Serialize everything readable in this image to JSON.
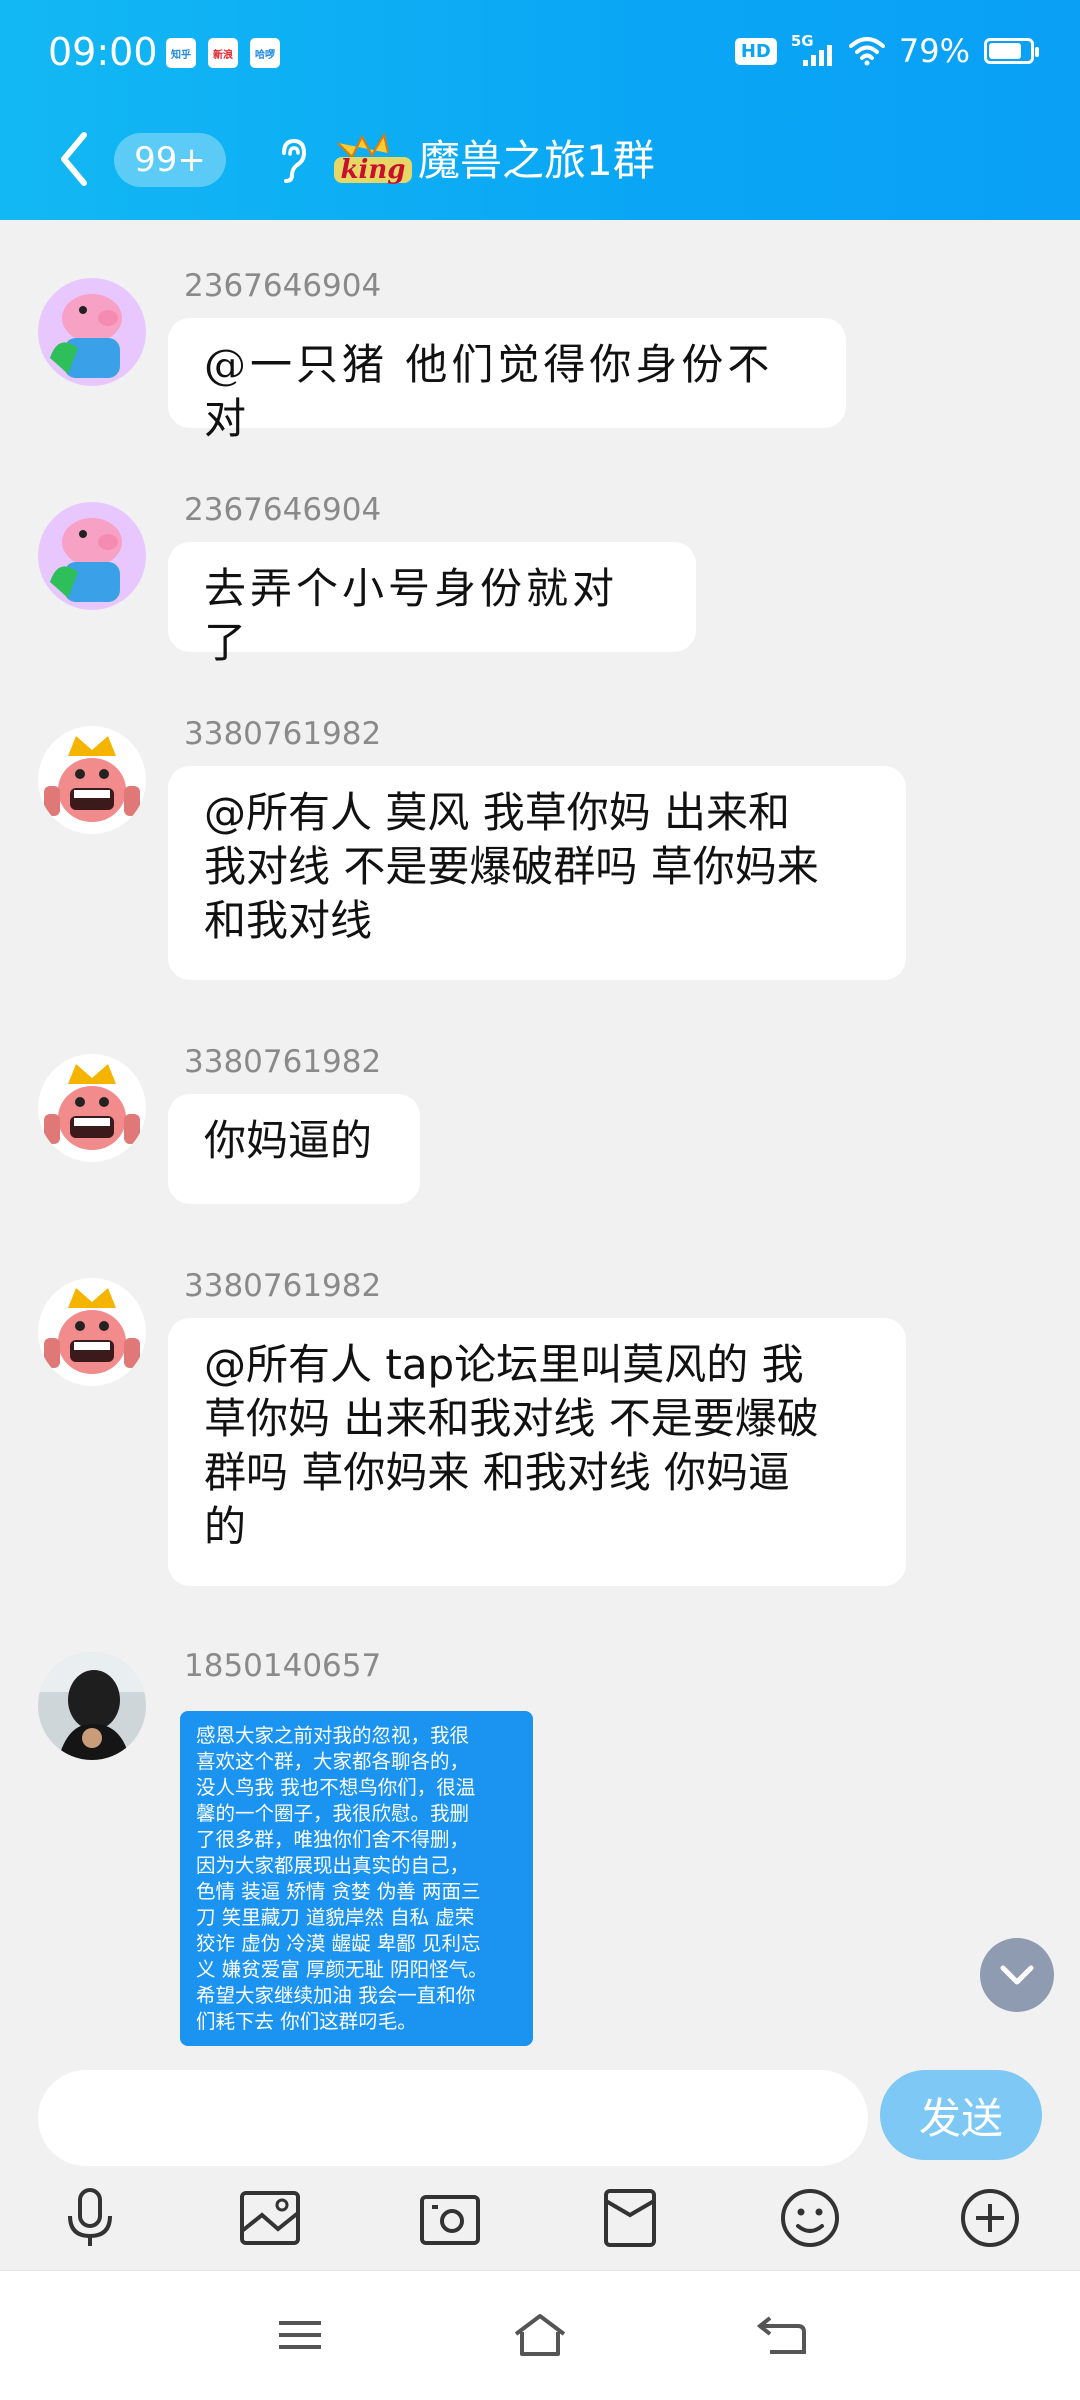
{
  "status_bar": {
    "time": "09:00",
    "apps": [
      "知乎",
      "新浪",
      "哈啰"
    ],
    "hd": "HD",
    "network": "5G",
    "battery": "79%",
    "battery_level": 0.79
  },
  "titlebar": {
    "unread_badge": "99+",
    "king_label": "king",
    "group_name": "魔兽之旅1群"
  },
  "messages": [
    {
      "sender": "2367646904",
      "text": "@一只猪 他们觉得你身份不对"
    },
    {
      "sender": "2367646904",
      "text": "去弄个小号身份就对了"
    },
    {
      "sender": "3380761982",
      "lines": [
        "@所有人  莫风 我草你妈 出来和",
        "我对线 不是要爆破群吗 草你妈来",
        "和我对线"
      ]
    },
    {
      "sender": "3380761982",
      "text": "你妈逼的"
    },
    {
      "sender": "3380761982",
      "lines": [
        "@所有人  tap论坛里叫莫风的 我",
        "草你妈 出来和我对线 不是要爆破",
        "群吗 草你妈来 和我对线 你妈逼",
        "的"
      ]
    },
    {
      "sender": "1850140657",
      "image_lines": [
        "感恩大家之前对我的忽视，我很",
        "喜欢这个群，大家都各聊各的，",
        "没人鸟我 我也不想鸟你们，很温",
        "馨的一个圈子，我很欣慰。我删",
        "了很多群，唯独你们舍不得删，",
        "因为大家都展现出真实的自己，",
        "色情 装逼 矫情 贪婪 伪善 两面三",
        "刀 笑里藏刀 道貌岸然 自私 虚荣",
        "狡诈 虚伪 冷漠 龌龊 卑鄙 见利忘",
        "义 嫌贫爱富 厚颜无耻 阴阳怪气。",
        "希望大家继续加油 我会一直和你",
        "们耗下去 你们这群叼毛。"
      ]
    }
  ],
  "input": {
    "placeholder": "",
    "send_label": "发送"
  },
  "toolbar_icons": [
    "microphone-icon",
    "image-icon",
    "camera-icon",
    "red-packet-icon",
    "emoji-icon",
    "plus-icon"
  ],
  "colors": {
    "header": "#0aa6f5",
    "send": "#7ec8f5",
    "image_bg": "#1b93f0"
  }
}
